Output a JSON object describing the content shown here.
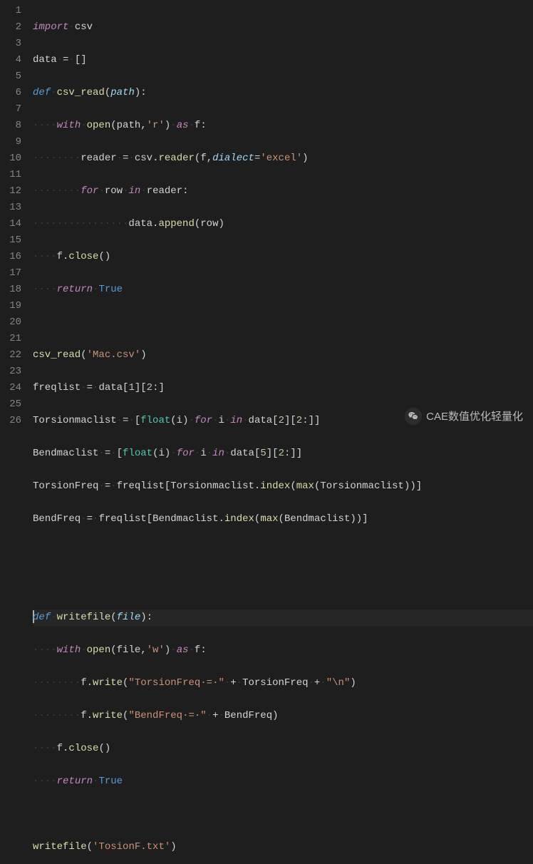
{
  "gutter": [
    "1",
    "2",
    "3",
    "4",
    "5",
    "6",
    "7",
    "8",
    "9",
    "10",
    "11",
    "12",
    "13",
    "14",
    "15",
    "16",
    "17",
    "18",
    "19",
    "20",
    "21",
    "22",
    "23",
    "24",
    "25",
    "26"
  ],
  "ws": {
    "indent1": "····",
    "indent2": "········",
    "indent3": "············",
    "indent4": "················",
    "dot": "·"
  },
  "tokens": {
    "import": "import",
    "def": "def",
    "with": "with",
    "as": "as",
    "for": "for",
    "in": "in",
    "return": "return",
    "True": "True",
    "open": "open",
    "float": "float",
    "max": "max"
  },
  "code": {
    "l1_mod": "csv",
    "l2_var": "data",
    "l2_val": "[]",
    "l3_fn": "csv_read",
    "l3_param": "path",
    "l4_arg1": "path",
    "l4_str": "'r'",
    "l4_f": "f",
    "l5_reader": "reader",
    "l5_csv": "csv",
    "l5_readerfn": "reader",
    "l5_f": "f",
    "l5_kwarg": "dialect",
    "l5_str": "'excel'",
    "l6_row": "row",
    "l6_reader": "reader",
    "l7_data": "data",
    "l7_append": "append",
    "l7_row": "row",
    "l8_f": "f",
    "l8_close": "close",
    "l11_fn": "csv_read",
    "l11_str": "'Mac.csv'",
    "l12_var": "freqlist",
    "l12_data": "data",
    "l12_n1": "1",
    "l12_n2": "2",
    "l13_var": "Torsionmaclist",
    "l13_i": "i",
    "l13_data": "data",
    "l13_n1": "2",
    "l13_n2": "2",
    "l14_var": "Bendmaclist",
    "l14_i": "i",
    "l14_data": "data",
    "l14_n1": "5",
    "l14_n2": "2",
    "l15_var": "TorsionFreq",
    "l15_freq": "freqlist",
    "l15_tml": "Torsionmaclist",
    "l15_index": "index",
    "l16_var": "BendFreq",
    "l16_freq": "freqlist",
    "l16_bml": "Bendmaclist",
    "l16_index": "index",
    "l19_fn": "writefile",
    "l19_param": "file",
    "l20_file": "file",
    "l20_str": "'w'",
    "l20_f": "f",
    "l21_f": "f",
    "l21_write": "write",
    "l21_str1": "\"TorsionFreq·=·\"",
    "l21_var": "TorsionFreq",
    "l21_str2": "\"\\n\"",
    "l22_f": "f",
    "l22_write": "write",
    "l22_str1": "\"BendFreq·=·\"",
    "l22_var": "BendFreq",
    "l23_f": "f",
    "l23_close": "close",
    "l26_fn": "writefile",
    "l26_str": "'TosionF.txt'"
  },
  "watermark": {
    "text": "CAE数值优化轻量化"
  }
}
